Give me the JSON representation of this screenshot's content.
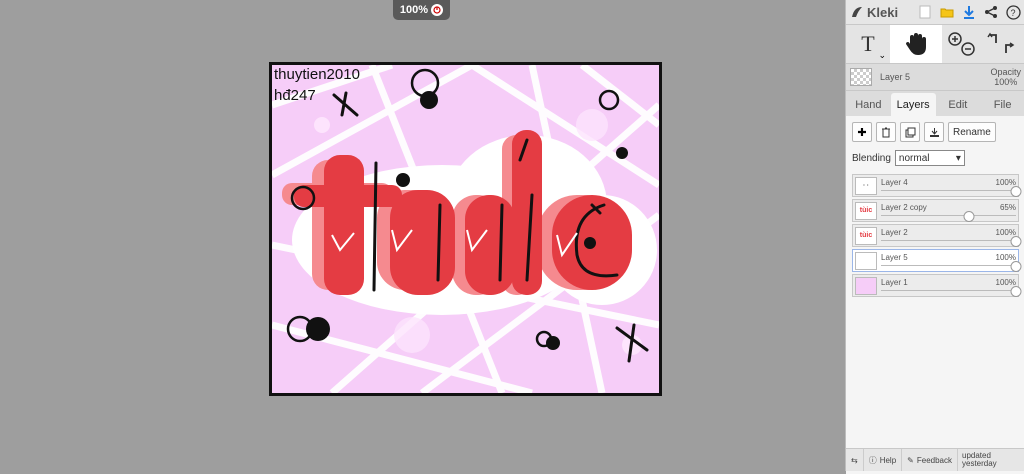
{
  "app": {
    "name": "Kleki"
  },
  "zoom": {
    "label": "100%"
  },
  "canvas": {
    "signature_line1": "thuytien2010",
    "signature_line2": "hđ247",
    "art_word": "tùic",
    "colors": {
      "background": "#f6cdf8",
      "red": "#e43c43",
      "pink": "#f58a8f"
    }
  },
  "toolbar": {
    "tools": [
      "text-tool",
      "hand-tool",
      "zoom-in",
      "zoom-out",
      "undo",
      "redo"
    ],
    "text_tool_glyph": "T"
  },
  "current_layer": {
    "name": "Layer 5",
    "opacity_label": "Opacity",
    "opacity_value": "100%"
  },
  "tabs": [
    {
      "label": "Hand",
      "active": false
    },
    {
      "label": "Layers",
      "active": true
    },
    {
      "label": "Edit",
      "active": false
    },
    {
      "label": "File",
      "active": false
    }
  ],
  "layer_actions": {
    "rename_label": "Rename"
  },
  "blending": {
    "label": "Blending",
    "value": "normal"
  },
  "layers": [
    {
      "name": "Layer 4",
      "opacity": "100%",
      "level": 1.0,
      "selected": false
    },
    {
      "name": "Layer 2 copy",
      "opacity": "65%",
      "level": 0.65,
      "selected": false
    },
    {
      "name": "Layer 2",
      "opacity": "100%",
      "level": 1.0,
      "selected": false
    },
    {
      "name": "Layer 5",
      "opacity": "100%",
      "level": 1.0,
      "selected": true
    },
    {
      "name": "Layer 1",
      "opacity": "100%",
      "level": 1.0,
      "selected": false
    }
  ],
  "footer": {
    "help": "Help",
    "feedback": "Feedback",
    "updated_line1": "updated",
    "updated_line2": "yesterday"
  }
}
